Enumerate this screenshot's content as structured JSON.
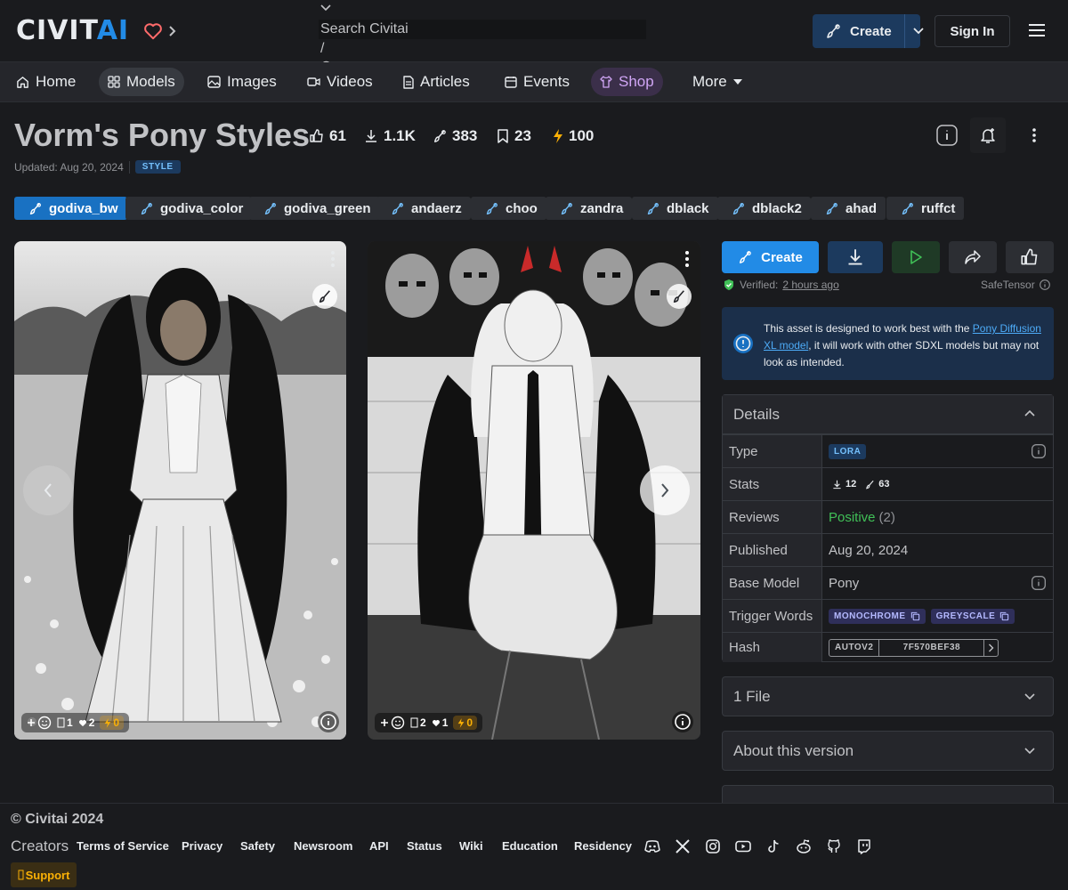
{
  "header": {
    "logo_text_1": "CIVIT",
    "logo_text_2": "AI",
    "search_placeholder": "Search Civitai",
    "search_shortcut": "/",
    "create_label": "Create",
    "signin_label": "Sign In"
  },
  "nav": {
    "items": [
      {
        "label": "Home",
        "icon": "home-icon"
      },
      {
        "label": "Models",
        "icon": "grid-icon"
      },
      {
        "label": "Images",
        "icon": "photo-icon"
      },
      {
        "label": "Videos",
        "icon": "video-icon"
      },
      {
        "label": "Articles",
        "icon": "file-text-icon"
      },
      {
        "label": "Events",
        "icon": "calendar-icon"
      },
      {
        "label": "Shop",
        "icon": "shirt-icon"
      },
      {
        "label": "More",
        "icon": "caret-down-icon"
      }
    ]
  },
  "model": {
    "title": "Vorm's Pony Styles",
    "stats": {
      "likes": "61",
      "downloads": "1.1K",
      "generations": "383",
      "bookmarks": "23",
      "buzz": "100"
    },
    "updated": "Updated: Aug 20, 2024",
    "type_badge": "STYLE"
  },
  "versions": [
    "godiva_bw",
    "godiva_color",
    "godiva_green",
    "andaerz",
    "choo",
    "zandra",
    "dblack",
    "dblack2",
    "ahad",
    "ruffct"
  ],
  "cards": [
    {
      "comments": "1",
      "hearts": "2",
      "buzz": "0"
    },
    {
      "comments": "2",
      "hearts": "1",
      "buzz": "0"
    }
  ],
  "sidebar": {
    "create_label": "Create",
    "verified_label": "Verified:",
    "verified_time": "2 hours ago",
    "file_format": "SafeTensor",
    "alert_pre": "This asset is designed to work best with the ",
    "alert_link": "Pony Diffusion XL model",
    "alert_post": ", it will work with other SDXL models but may not look as intended.",
    "details_title": "Details",
    "details": {
      "type_label": "Type",
      "type_value": "LORA",
      "stats_label": "Stats",
      "stats_downloads": "12",
      "stats_generations": "63",
      "reviews_label": "Reviews",
      "reviews_value": "Positive",
      "reviews_count": "(2)",
      "published_label": "Published",
      "published_value": "Aug 20, 2024",
      "base_label": "Base Model",
      "base_value": "Pony",
      "trigger_label": "Trigger Words",
      "trigger_words": [
        "MONOCHROME",
        "GREYSCALE"
      ],
      "hash_label": "Hash",
      "hash_type": "AUTOV2",
      "hash_value": "7F570BEF38"
    },
    "files_label": "1 File",
    "about_label": "About this version"
  },
  "footer": {
    "copyright": "© Civitai 2024",
    "creators": "Creators",
    "links": [
      "Terms of Service",
      "Privacy",
      "Safety",
      "Newsroom",
      "API",
      "Status",
      "Wiki",
      "Education",
      "Residency"
    ],
    "support": "Support"
  },
  "colors": {
    "accent": "#228be6",
    "background": "#1a1b1e",
    "positive": "#40c057",
    "buzz": "#fab005"
  }
}
